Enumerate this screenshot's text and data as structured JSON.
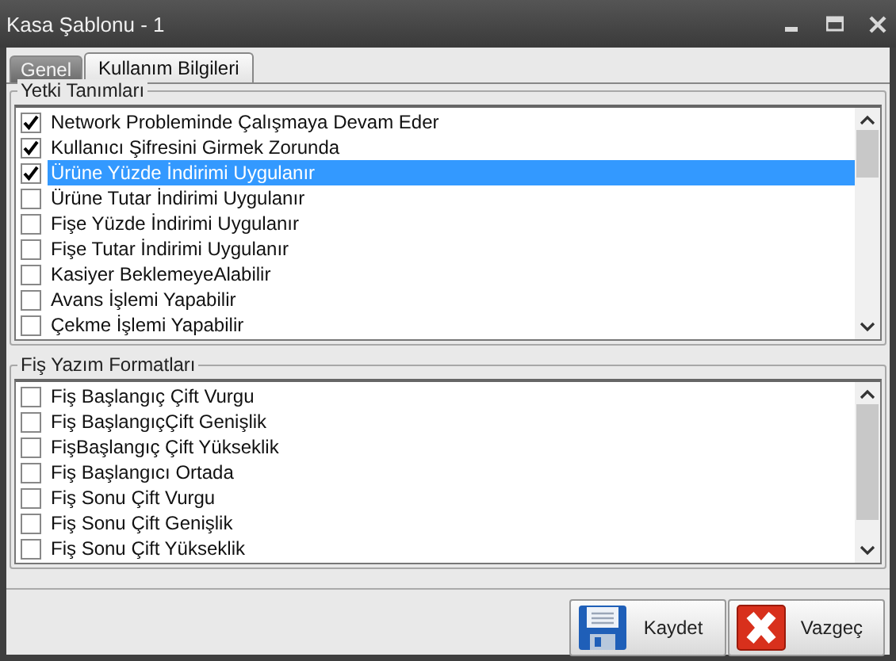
{
  "window": {
    "title": "Kasa Şablonu - 1"
  },
  "tabs": [
    {
      "label": "Genel",
      "selected": false
    },
    {
      "label": "Kullanım Bilgileri",
      "selected": true
    }
  ],
  "groups": [
    {
      "title": "Yetki Tanımları",
      "items": [
        {
          "label": "Network Probleminde Çalışmaya Devam Eder",
          "checked": true,
          "selected": false
        },
        {
          "label": "Kullanıcı Şifresini Girmek Zorunda",
          "checked": true,
          "selected": false
        },
        {
          "label": "Ürüne Yüzde İndirimi Uygulanır",
          "checked": true,
          "selected": true
        },
        {
          "label": "Ürüne Tutar İndirimi Uygulanır",
          "checked": false,
          "selected": false
        },
        {
          "label": "Fişe Yüzde İndirimi Uygulanır",
          "checked": false,
          "selected": false
        },
        {
          "label": "Fişe Tutar İndirimi Uygulanır",
          "checked": false,
          "selected": false
        },
        {
          "label": "Kasiyer BeklemeyeAlabilir",
          "checked": false,
          "selected": false
        },
        {
          "label": "Avans İşlemi Yapabilir",
          "checked": false,
          "selected": false
        },
        {
          "label": "Çekme İşlemi Yapabilir",
          "checked": false,
          "selected": false
        }
      ]
    },
    {
      "title": "Fiş Yazım Formatları",
      "items": [
        {
          "label": "Fiş Başlangıç Çift Vurgu",
          "checked": false,
          "selected": false
        },
        {
          "label": "Fiş BaşlangıçÇift Genişlik",
          "checked": false,
          "selected": false
        },
        {
          "label": "FişBaşlangıç Çift Yükseklik",
          "checked": false,
          "selected": false
        },
        {
          "label": "Fiş Başlangıcı Ortada",
          "checked": false,
          "selected": false
        },
        {
          "label": "Fiş Sonu Çift Vurgu",
          "checked": false,
          "selected": false
        },
        {
          "label": "Fiş Sonu Çift Genişlik",
          "checked": false,
          "selected": false
        },
        {
          "label": "Fiş Sonu Çift Yükseklik",
          "checked": false,
          "selected": false
        }
      ]
    }
  ],
  "buttons": [
    {
      "kind": "save",
      "label": "Kaydet"
    },
    {
      "kind": "cancel",
      "label": "Vazgeç"
    }
  ]
}
